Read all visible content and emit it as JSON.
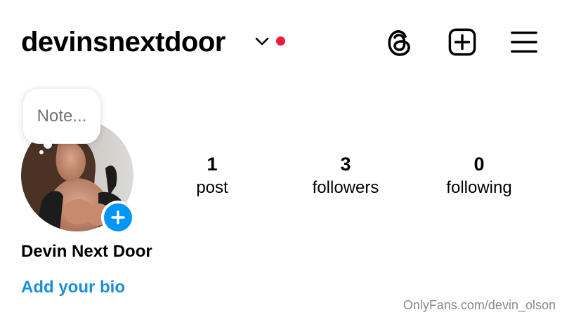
{
  "header": {
    "username": "devinsnextdoor",
    "chevron_icon": "chevron-down-icon",
    "notification_color": "#ed1c3e",
    "icons": [
      "threads-icon",
      "add-post-icon",
      "menu-icon"
    ]
  },
  "note": {
    "placeholder": "Note..."
  },
  "profile": {
    "avatar_alt": "Profile photo",
    "add_story_icon": "plus-icon",
    "add_story_color": "#0095f6",
    "display_name": "Devin Next Door",
    "bio_link": "Add your bio",
    "bio_link_color": "#1a8fd9"
  },
  "stats": [
    {
      "value": "1",
      "label": "post"
    },
    {
      "value": "3",
      "label": "followers"
    },
    {
      "value": "0",
      "label": "following"
    }
  ],
  "watermark": "OnlyFans.com/devin_olson"
}
